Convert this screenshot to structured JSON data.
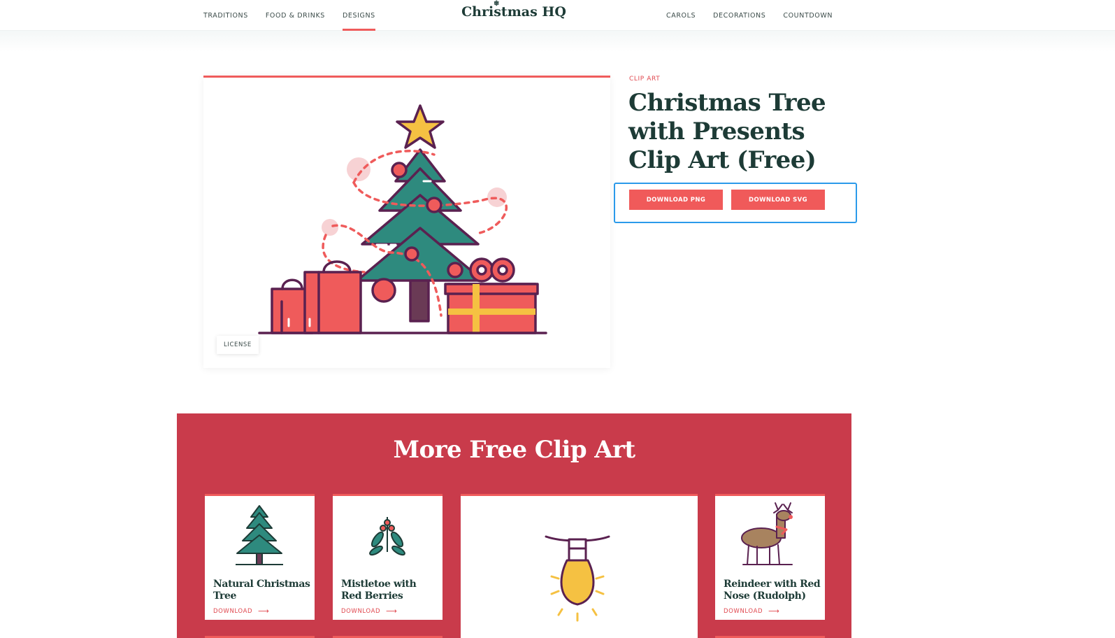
{
  "header": {
    "nav_left": [
      "TRADITIONS",
      "FOOD & DRINKS",
      "DESIGNS"
    ],
    "nav_right": [
      "CAROLS",
      "DECORATIONS",
      "COUNTDOWN"
    ],
    "active_item": "DESIGNS",
    "logo": "Christmas HQ"
  },
  "hero": {
    "eyebrow": "CLIP ART",
    "title": "Christmas Tree with Presents Clip Art (Free)",
    "license_label": "LICENSE",
    "download_png": "DOWNLOAD PNG",
    "download_svg": "DOWNLOAD SVG"
  },
  "more": {
    "title": "More Free Clip Art",
    "cards": [
      {
        "title": "Natural Christmas Tree",
        "link": "DOWNLOAD",
        "icon": "christmas-tree-icon"
      },
      {
        "title": "Mistletoe with Red Berries",
        "link": "DOWNLOAD",
        "icon": "mistletoe-icon"
      },
      {
        "title": "",
        "link": "",
        "icon": "christmas-light-bulb-icon"
      },
      {
        "title": "Reindeer with Red Nose (Rudolph)",
        "link": "DOWNLOAD",
        "icon": "reindeer-icon"
      }
    ]
  },
  "colors": {
    "accent": "#ef5b5b",
    "dark_green": "#1d3b36",
    "section_red": "#c93b4b",
    "highlight_blue": "#2b9aea"
  }
}
